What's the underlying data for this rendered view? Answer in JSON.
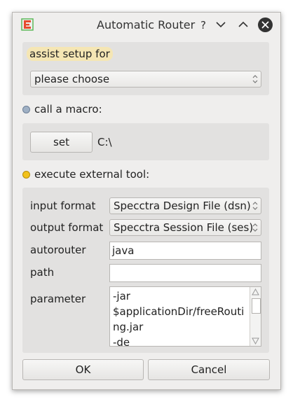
{
  "window": {
    "title": "Automatic Router",
    "help_glyph": "?",
    "minimize_glyph": "∨",
    "maximize_glyph": "∧"
  },
  "assist": {
    "label": "assist setup for",
    "selected": "please choose"
  },
  "macro": {
    "radio_label": "call a macro:",
    "set_button": "set",
    "path_value": "C:\\"
  },
  "external": {
    "radio_label": "execute external tool:",
    "input_format_label": "input format",
    "input_format_value": "Specctra Design File (dsn)",
    "output_format_label": "output format",
    "output_format_value": "Specctra Session File (ses)",
    "autorouter_label": "autorouter",
    "autorouter_value": "java",
    "path_label": "path",
    "path_value": "",
    "parameter_label": "parameter",
    "parameter_lines": [
      "-jar",
      "$applicationDir/freeRouti",
      "ng.jar",
      "-de"
    ]
  },
  "buttons": {
    "ok": "OK",
    "cancel": "Cancel"
  },
  "colors": {
    "radio_selected": "#f2c21b",
    "radio_unselected": "#9fb0c4",
    "app_icon": "#e64a2e",
    "highlight": "#f5e6b4"
  },
  "icons": {
    "app": "app-logo-icon",
    "close": "close-icon",
    "combo_arrow": "chevron-updown-icon"
  }
}
